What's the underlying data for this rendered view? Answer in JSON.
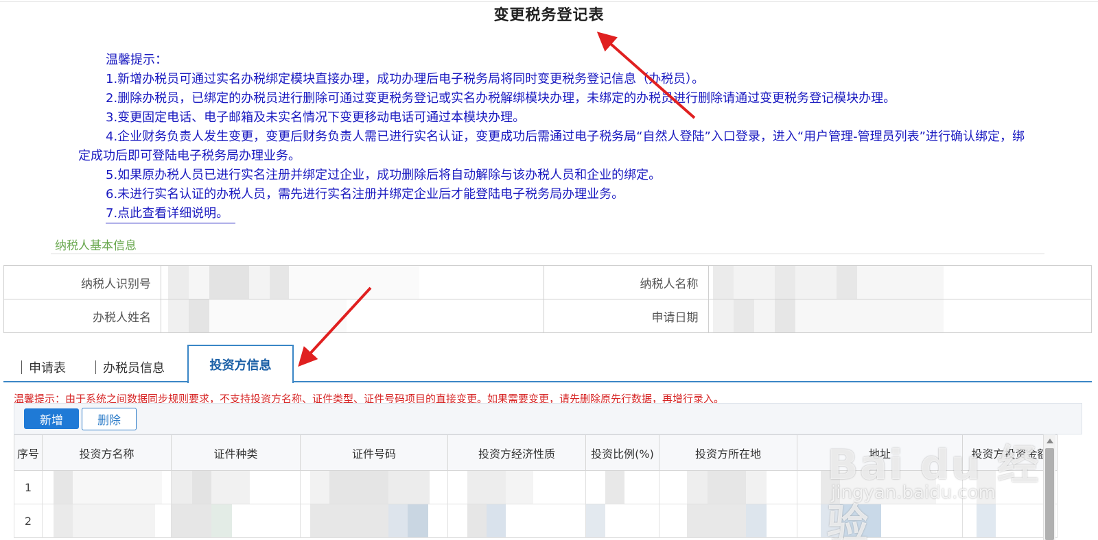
{
  "page": {
    "title": "变更税务登记表"
  },
  "tips": {
    "heading": "温馨提示：",
    "items": [
      "1.新增办税员可通过实名办税绑定模块直接办理，成功办理后电子税务局将同时变更税务登记信息（办税员）。",
      "2.删除办税员，已绑定的办税员进行删除可通过变更税务登记或实名办税解绑模块办理，未绑定的办税员进行删除请通过变更税务登记模块办理。",
      "3.变更固定电话、电子邮箱及未实名情况下变更移动电话可通过本模块办理。",
      "4.企业财务负责人发生变更，变更后财务负责人需已进行实名认证，变更成功后需通过电子税务局“自然人登陆”入口登录，进入“用户管理-管理员列表”进行确认绑定，绑定成功后即可登陆电子税务局办理业务。",
      "5.如果原办税人员已进行实名注册并绑定过企业，成功删除后将自动解除与该办税人员和企业的绑定。",
      "6.未进行实名认证的办税人员，需先进行实名注册并绑定企业后才能登陆电子税务局办理业务。"
    ],
    "link": "7.点此查看详细说明。"
  },
  "basic_info": {
    "section_title": "纳税人基本信息",
    "taxpayer_id_label": "纳税人识别号",
    "taxpayer_name_label": "纳税人名称",
    "handler_name_label": "办税人姓名",
    "apply_date_label": "申请日期"
  },
  "tabs": {
    "application": "申请表",
    "tax_officer": "办税员信息",
    "investor": "投资方信息"
  },
  "investor": {
    "warning": "温馨提示：由于系统之间数据同步规则要求，不支持投资方名称、证件类型、证件号码项目的直接变更。如果需要变更，请先删除原先行数据，再增行录入。",
    "add_label": "新增",
    "delete_label": "删除",
    "columns": [
      "序号",
      "投资方名称",
      "证件种类",
      "证件号码",
      "投资方经济性质",
      "投资比例(%)",
      "投资方所在地",
      "地址",
      "投资方投资金额"
    ],
    "rows": [
      "1",
      "2"
    ]
  },
  "watermark": {
    "logo": "Bai du 经验",
    "sub": "jingyan.baidu.com"
  },
  "colors": {
    "accent": "#3a86c6",
    "tip_text": "#1a1ac0",
    "warning": "#d62626",
    "section": "#6aa84f",
    "annotation_arrow": "#e02020"
  }
}
